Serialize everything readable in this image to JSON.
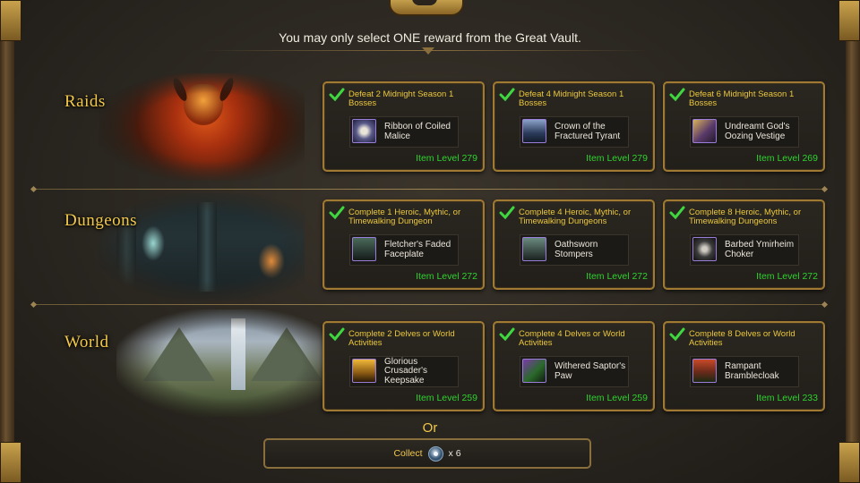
{
  "header": {
    "message": "You may only select ONE reward from the Great Vault."
  },
  "categories": [
    {
      "title": "Raids"
    },
    {
      "title": "Dungeons"
    },
    {
      "title": "World"
    }
  ],
  "rewards": {
    "raids": [
      {
        "requirement": "Defeat 2 Midnight Season 1 Bosses",
        "item_name": "Ribbon of Coiled Malice",
        "item_level": "Item Level 279",
        "icon": "ribbon-ring-icon",
        "completed": true
      },
      {
        "requirement": "Defeat 4 Midnight Season 1 Bosses",
        "item_name": "Crown of the Fractured Tyrant",
        "item_level": "Item Level 279",
        "icon": "crown-helm-icon",
        "completed": true
      },
      {
        "requirement": "Defeat 6 Midnight Season 1 Bosses",
        "item_name": "Undreamt God's Oozing Vestige",
        "item_level": "Item Level 269",
        "icon": "vestige-trinket-icon",
        "completed": true
      }
    ],
    "dungeons": [
      {
        "requirement": "Complete 1 Heroic, Mythic, or Timewalking Dungeon",
        "item_name": "Fletcher's Faded Faceplate",
        "item_level": "Item Level 272",
        "icon": "faceplate-helm-icon",
        "completed": true
      },
      {
        "requirement": "Complete 4 Heroic, Mythic, or Timewalking Dungeons",
        "item_name": "Oathsworn Stompers",
        "item_level": "Item Level 272",
        "icon": "stompers-boots-icon",
        "completed": true
      },
      {
        "requirement": "Complete 8 Heroic, Mythic, or Timewalking Dungeons",
        "item_name": "Barbed Ymirheim Choker",
        "item_level": "Item Level 272",
        "icon": "choker-neck-icon",
        "completed": true
      }
    ],
    "world": [
      {
        "requirement": "Complete 2 Delves or World Activities",
        "item_name": "Glorious Crusader's Keepsake",
        "item_level": "Item Level 259",
        "icon": "keepsake-trinket-icon",
        "completed": true
      },
      {
        "requirement": "Complete 4 Delves or World Activities",
        "item_name": "Withered Saptor's Paw",
        "item_level": "Item Level 259",
        "icon": "paw-trinket-icon",
        "completed": true
      },
      {
        "requirement": "Complete 8 Delves or World Activities",
        "item_name": "Rampant Bramblecloak",
        "item_level": "Item Level 233",
        "icon": "bramblecloak-cloak-icon",
        "completed": true
      }
    ]
  },
  "alternative": {
    "or_label": "Or",
    "collect_label": "Collect",
    "currency_icon": "valorstone-coin-icon",
    "quantity": "x 6"
  },
  "colors": {
    "gold_text": "#f2c94c",
    "requirement_text": "#ebc83c",
    "item_level_text": "#2fd22f",
    "card_border": "#a07a32",
    "epic_border": "#9a7dd8"
  }
}
